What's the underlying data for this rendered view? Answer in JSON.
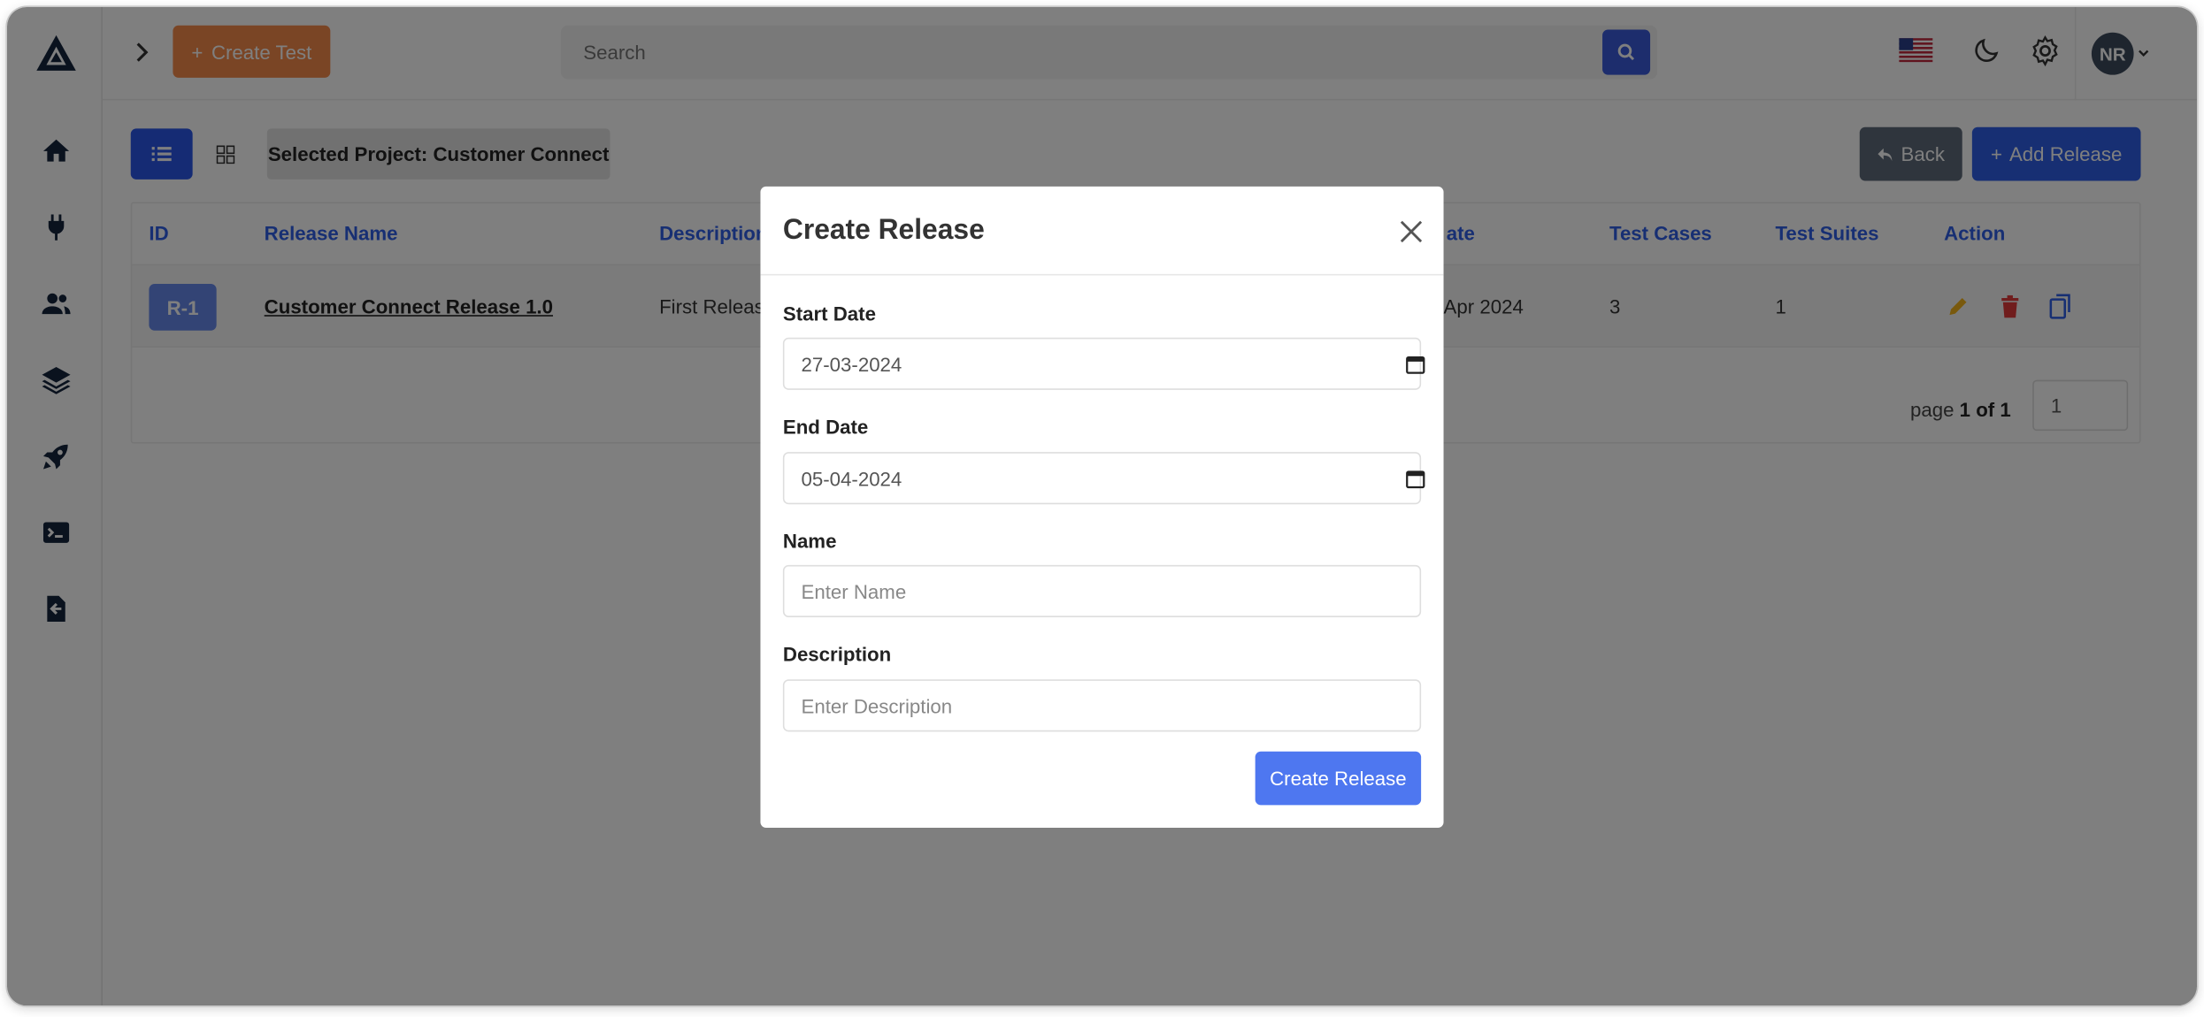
{
  "header": {
    "create_test_label": "Create Test",
    "search_placeholder": "Search",
    "avatar_initials": "NR"
  },
  "sidebar": {
    "items": [
      {
        "name": "home",
        "icon": "home-icon"
      },
      {
        "name": "plugins",
        "icon": "plug-icon"
      },
      {
        "name": "users",
        "icon": "users-icon"
      },
      {
        "name": "layers",
        "icon": "layers-icon"
      },
      {
        "name": "releases",
        "icon": "rocket-icon"
      },
      {
        "name": "terminal",
        "icon": "terminal-icon"
      },
      {
        "name": "import",
        "icon": "file-import-icon"
      }
    ]
  },
  "toolbar": {
    "selected_project": "Selected Project: Customer Connect",
    "back_label": "Back",
    "add_release_label": "Add Release"
  },
  "table": {
    "columns": {
      "id": "ID",
      "release_name": "Release Name",
      "description": "Description",
      "end_date": "ate",
      "test_cases": "Test Cases",
      "test_suites": "Test Suites",
      "action": "Action"
    },
    "rows": [
      {
        "id": "R-1",
        "release_name": "Customer Connect Release 1.0",
        "description": "First Releas",
        "end_date": "Apr 2024",
        "test_cases": "3",
        "test_suites": "1"
      }
    ],
    "pager": {
      "prefix": "page",
      "current": "1",
      "of": "of",
      "total": "1",
      "input_value": "1"
    }
  },
  "modal": {
    "title": "Create Release",
    "start_date_label": "Start Date",
    "start_date_value": "27-03-2024",
    "end_date_label": "End Date",
    "end_date_value": "05-04-2024",
    "name_label": "Name",
    "name_placeholder": "Enter Name",
    "description_label": "Description",
    "description_placeholder": "Enter Description",
    "submit_label": "Create Release"
  },
  "colors": {
    "primary": "#2f5fe6",
    "create_test": "#f58a4b",
    "back": "#5f6b7a",
    "edit": "#f2b31a",
    "delete": "#e03b3b",
    "copy": "#2f5fe6"
  }
}
